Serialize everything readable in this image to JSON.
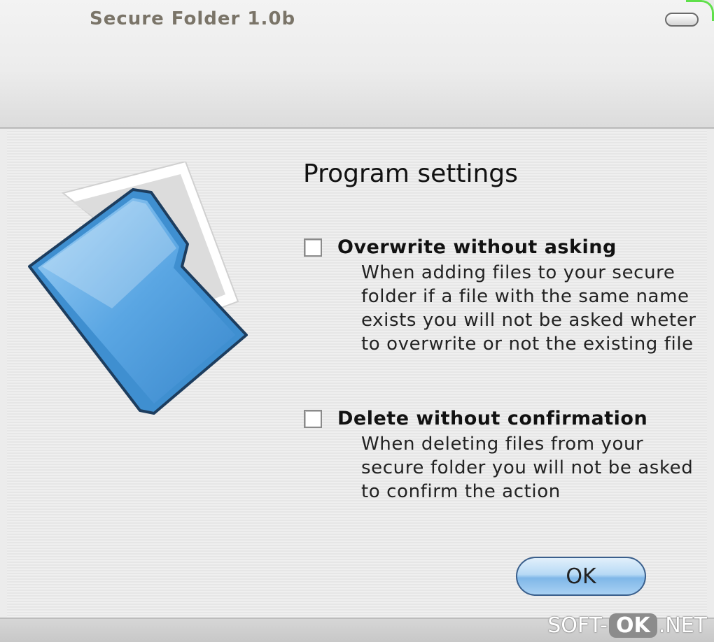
{
  "window": {
    "title": "Secure Folder 1.0b",
    "minimize_icon": "minimize-icon"
  },
  "main": {
    "heading": "Program settings",
    "illustration_icon": "blue-folder-icon",
    "options": [
      {
        "label": "Overwrite without asking",
        "checked": false,
        "description": "When adding files to your secure folder if a file with the same name exists you will not be asked wheter to overwrite or not the existing file"
      },
      {
        "label": "Delete without confirmation",
        "checked": false,
        "description": "When deleting files from your secure folder you will not be asked to confirm the action"
      }
    ],
    "ok_label": "OK"
  },
  "watermark": {
    "left": "SOFT-",
    "middle": "OK",
    "right": ".NET"
  },
  "colors": {
    "accent_glow": "#5fe04a",
    "ok_button": "#7fb7e8",
    "folder_blue": "#4a9ad8"
  }
}
